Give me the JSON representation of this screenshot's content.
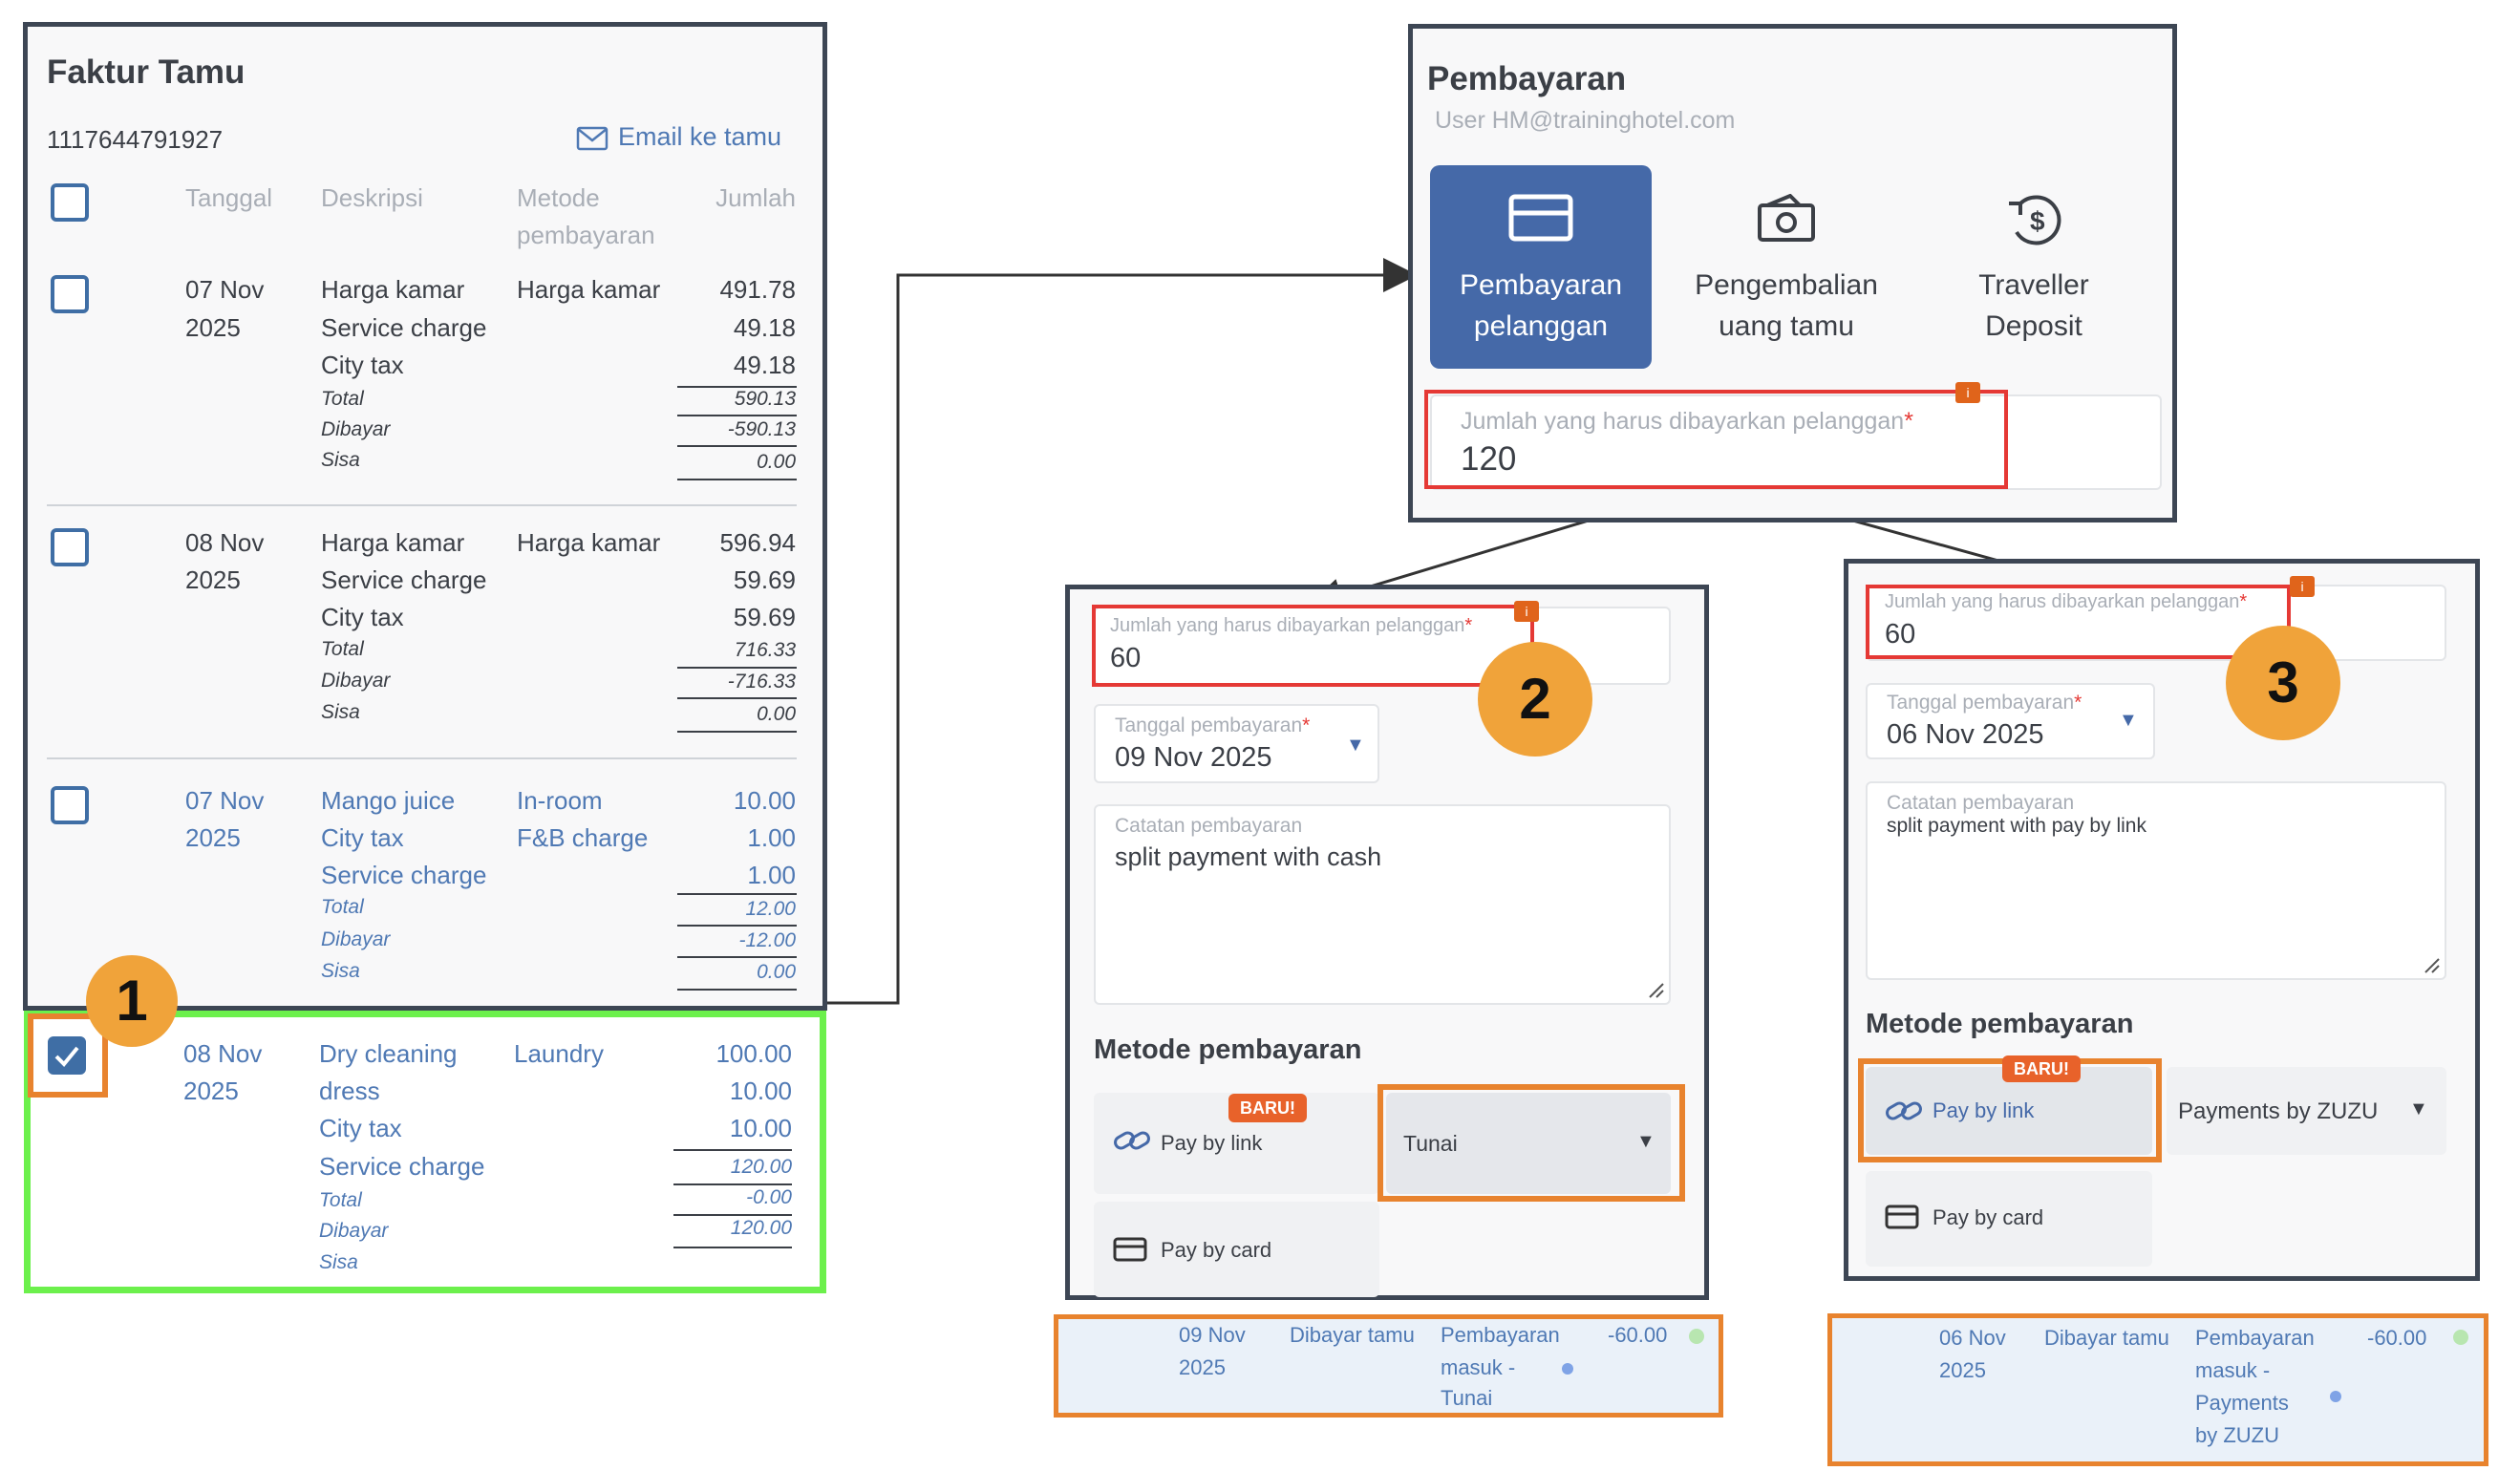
{
  "invoice": {
    "title": "Faktur Tamu",
    "number": "1117644791927",
    "email_label": "Email ke tamu",
    "headers": {
      "date": "Tanggal",
      "desc": "Deskripsi",
      "method_1": "Metode",
      "method_2": "pembayaran",
      "amount": "Jumlah"
    },
    "groups": [
      {
        "day": "07 Nov",
        "year": "2025",
        "items": [
          "Harga kamar",
          "Service charge",
          "City tax"
        ],
        "method_1": "Harga kamar",
        "method_2": "",
        "amounts": [
          "491.78",
          "49.18",
          "49.18"
        ],
        "total": "590.13",
        "paid": "-590.13",
        "rest": "0.00"
      },
      {
        "day": "08 Nov",
        "year": "2025",
        "items": [
          "Harga kamar",
          "Service charge",
          "City tax"
        ],
        "method_1": "Harga kamar",
        "method_2": "",
        "amounts": [
          "596.94",
          "59.69",
          "59.69"
        ],
        "total": "716.33",
        "paid": "-716.33",
        "rest": "0.00"
      },
      {
        "day": "07 Nov",
        "year": "2025",
        "items": [
          "Mango juice",
          "City tax",
          "Service charge"
        ],
        "method_1": "In-room",
        "method_2": "F&B charge",
        "amounts": [
          "10.00",
          "1.00",
          "1.00"
        ],
        "total": "12.00",
        "paid": "-12.00",
        "rest": "0.00"
      },
      {
        "day": "08 Nov",
        "year": "2025",
        "items": [
          "Dry cleaning",
          "dress",
          "City tax",
          "Service charge"
        ],
        "method_1": "Laundry",
        "method_2": "",
        "amounts": [
          "100.00",
          "10.00",
          "10.00",
          "120.00",
          "-0.00",
          "120.00"
        ]
      }
    ],
    "lbl_total": "Total",
    "lbl_paid": "Dibayar",
    "lbl_rest": "Sisa"
  },
  "payment": {
    "title": "Pembayaran",
    "user": "User HM@traininghotel.com",
    "tabs": [
      {
        "line1": "Pembayaran",
        "line2": "pelanggan",
        "icon": "credit-card-icon",
        "active": true
      },
      {
        "line1": "Pengembalian",
        "line2": "uang tamu",
        "icon": "cash-icon",
        "active": false
      },
      {
        "line1": "Traveller",
        "line2": "Deposit",
        "icon": "dollar-return-icon",
        "active": false
      }
    ],
    "amount_label": "Jumlah yang harus dibayarkan pelanggan",
    "amount_value": "120",
    "required": "*",
    "info": "i",
    "accent": "#4569a8"
  },
  "split_cash": {
    "amount_label": "Jumlah yang harus dibayarkan pelanggan",
    "amount_value": "60",
    "date_label": "Tanggal pembayaran",
    "date_value": "09 Nov 2025",
    "note_label": "Catatan pembayaran",
    "note_value": "split payment with cash",
    "methods_label": "Metode pembayaran",
    "new_badge": "BARU!",
    "pay_by_link": "Pay by link",
    "select_value": "Tunai",
    "pay_by_card": "Pay by card",
    "result": {
      "day": "09 Nov",
      "year": "2025",
      "type": "Dibayar tamu",
      "desc_1": "Pembayaran",
      "desc_2": "masuk -",
      "desc_3": "Tunai",
      "desc_4": "",
      "amount": "-60.00"
    }
  },
  "split_link": {
    "amount_label": "Jumlah yang harus dibayarkan pelanggan",
    "amount_value": "60",
    "date_label": "Tanggal pembayaran",
    "date_value": "06 Nov 2025",
    "note_label": "Catatan pembayaran",
    "note_value": "split payment with pay by link",
    "methods_label": "Metode pembayaran",
    "new_badge": "BARU!",
    "pay_by_link": "Pay by link",
    "select_value": "Payments by ZUZU",
    "pay_by_card": "Pay by card",
    "result": {
      "day": "06 Nov",
      "year": "2025",
      "type": "Dibayar tamu",
      "desc_1": "Pembayaran",
      "desc_2": "masuk -",
      "desc_3": "Payments",
      "desc_4": "by ZUZU",
      "amount": "-60.00"
    }
  },
  "steps": [
    "1",
    "2",
    "3"
  ]
}
